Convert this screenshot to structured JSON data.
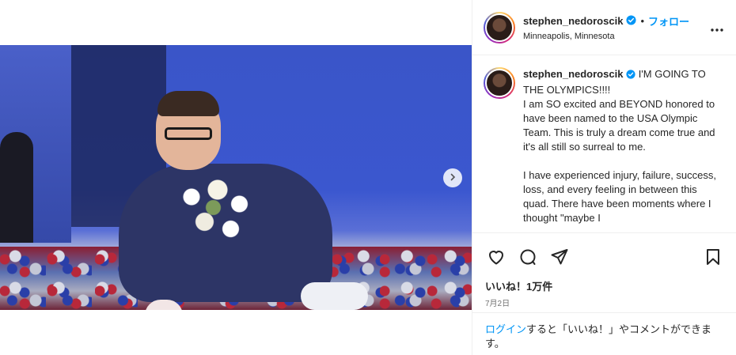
{
  "post": {
    "username": "stephen_nedoroscik",
    "follow_label": "フォロー",
    "dot_separator": "•",
    "location": "Minneapolis, Minnesota"
  },
  "caption": {
    "username": "stephen_nedoroscik",
    "paragraphs": [
      "I'M GOING TO THE OLYMPICS!!!!",
      "I am SO excited and BEYOND honored to have been named to the USA Olympic Team. This is truly a dream come true and it's all still so surreal to me.",
      "I have experienced injury, failure, success, loss, and every feeling in between this quad. There have been moments where I thought \"maybe I"
    ]
  },
  "engagement": {
    "likes": "いいね！1万件",
    "date": "7月2日"
  },
  "login_prompt": {
    "link": "ログイン",
    "text": "すると「いいね！」やコメントができます。"
  },
  "carousel": {
    "total_slides": 2,
    "active_index": 0
  },
  "icons": {
    "verified": "verified-badge-icon",
    "more": "more-options-icon",
    "like": "heart-icon",
    "comment": "comment-icon",
    "share": "share-icon",
    "save": "bookmark-icon",
    "next": "chevron-right-icon",
    "tagged": "user-tag-icon"
  },
  "colors": {
    "accent": "#0095f6",
    "verified": "#0095f6",
    "text": "#262626",
    "muted": "#737373"
  }
}
